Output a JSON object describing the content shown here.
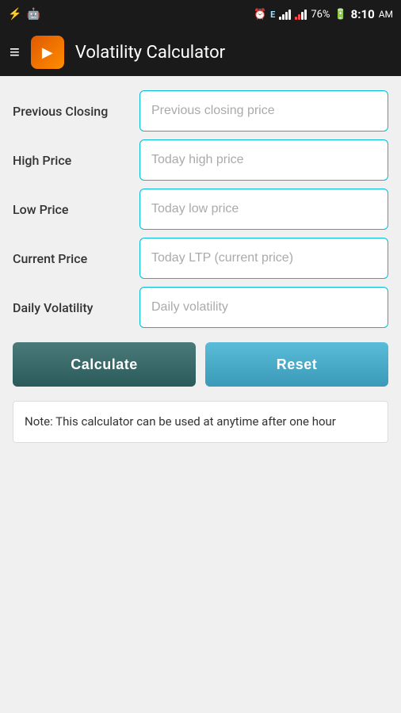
{
  "statusBar": {
    "leftIcons": [
      "usb-icon",
      "android-icon"
    ],
    "alarm": "⏰",
    "battery": "76%",
    "time": "8:10",
    "ampm": "AM"
  },
  "titleBar": {
    "menuLabel": "≡",
    "appTitle": "Volatility Calculator"
  },
  "form": {
    "fields": [
      {
        "label": "Previous Closing",
        "placeholder": "Previous closing price",
        "name": "previous-closing-input"
      },
      {
        "label": "High Price",
        "placeholder": "Today high price",
        "name": "high-price-input"
      },
      {
        "label": "Low Price",
        "placeholder": "Today low price",
        "name": "low-price-input"
      },
      {
        "label": "Current Price",
        "placeholder": "Today LTP (current price)",
        "name": "current-price-input"
      },
      {
        "label": "Daily Volatility",
        "placeholder": "Daily volatility",
        "name": "daily-volatility-input"
      }
    ],
    "calculateLabel": "Calculate",
    "resetLabel": "Reset"
  },
  "note": {
    "text": "Note: This calculator can be used at anytime after one hour"
  }
}
